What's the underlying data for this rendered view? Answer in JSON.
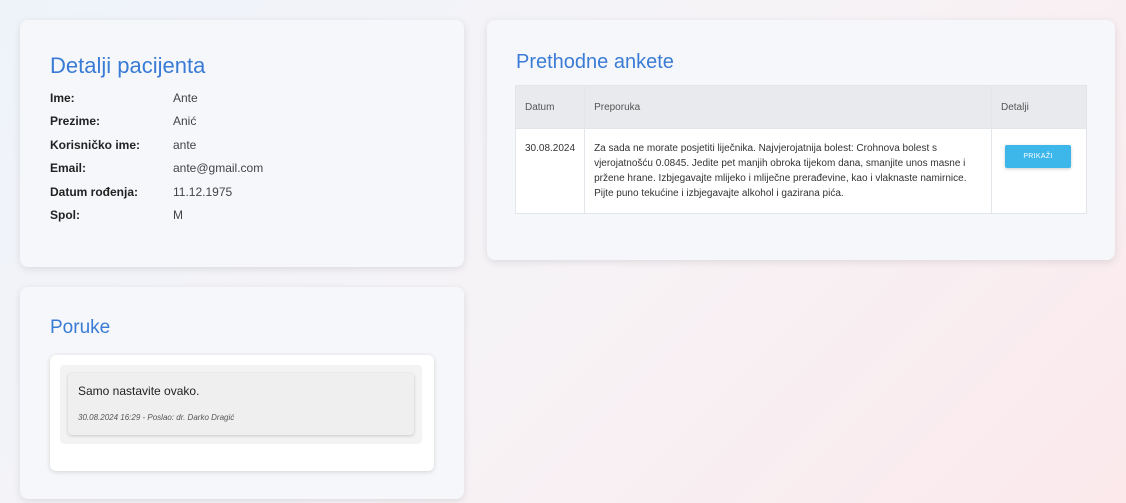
{
  "patient": {
    "title": "Detalji pacijenta",
    "rows": [
      {
        "label": "Ime:",
        "value": "Ante"
      },
      {
        "label": "Prezime:",
        "value": "Anić"
      },
      {
        "label": "Korisničko ime:",
        "value": "ante"
      },
      {
        "label": "Email:",
        "value": "ante@gmail.com"
      },
      {
        "label": "Datum rođenja:",
        "value": "11.12.1975"
      },
      {
        "label": "Spol:",
        "value": "M"
      }
    ]
  },
  "surveys": {
    "title": "Prethodne ankete",
    "headers": {
      "date": "Datum",
      "recommendation": "Preporuka",
      "details": "Detalji"
    },
    "rows": [
      {
        "date": "30.08.2024",
        "recommendation": "Za sada ne morate posjetiti liječnika. Najvjerojatnija bolest: Crohnova bolest s vjerojatnošću 0.0845. Jedite pet manjih obroka tijekom dana, smanjite unos masne i pržene hrane. Izbjegavajte mlijeko i mliječne prerađevine, kao i vlaknaste namirnice. Pijte puno tekućine i izbjegavajte alkohol i gazirana pića.",
        "button_label": "PRIKAŽI"
      }
    ]
  },
  "messages": {
    "title": "Poruke",
    "items": [
      {
        "text": "Samo nastavite ovako.",
        "meta": "30.08.2024 16:29 - Poslao: dr. Darko Dragić"
      }
    ]
  },
  "colors": {
    "accent": "#3a7bd5",
    "button": "#3db7ea"
  }
}
